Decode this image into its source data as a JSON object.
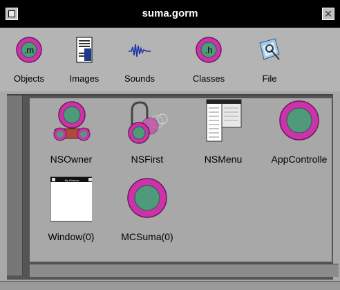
{
  "window": {
    "title": "suma.gorm",
    "close_glyph": "✕"
  },
  "toolbar": {
    "items": [
      {
        "label": "Objects",
        "icon": "objects-icon"
      },
      {
        "label": "Images",
        "icon": "images-icon"
      },
      {
        "label": "Sounds",
        "icon": "sounds-icon"
      },
      {
        "label": "Classes",
        "icon": "classes-icon"
      },
      {
        "label": "File",
        "icon": "file-icon"
      }
    ]
  },
  "objects": [
    {
      "label": "NSOwner",
      "icon": "owner-icon"
    },
    {
      "label": "NSFirst",
      "icon": "first-responder-icon"
    },
    {
      "label": "NSMenu",
      "icon": "menu-icon"
    },
    {
      "label": "AppControlle",
      "icon": "app-controller-icon"
    },
    {
      "label": "Window(0)",
      "icon": "window-icon"
    },
    {
      "label": "MCSuma(0)",
      "icon": "mcsuma-icon"
    }
  ],
  "colors": {
    "object_magenta": "#cc33aa",
    "object_green": "#4f9a7a",
    "titlebar": "#000000"
  }
}
